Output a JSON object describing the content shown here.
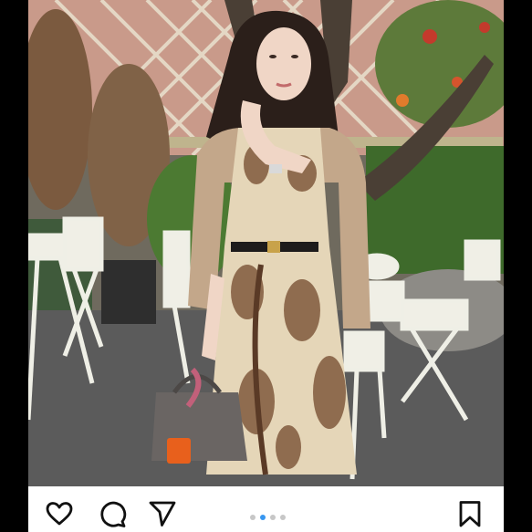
{
  "post": {
    "image_alt": "",
    "carousel": {
      "count": 4,
      "active_index": 1
    }
  },
  "actions": {
    "like_icon": "heart-icon",
    "comment_icon": "comment-bubble-icon",
    "share_icon": "paper-plane-icon",
    "save_icon": "bookmark-icon"
  },
  "colors": {
    "background": "#000000",
    "action_bar": "#ffffff",
    "icon": "#111111",
    "dot_active": "#3897f0",
    "dot_inactive": "#c7c7c7"
  }
}
